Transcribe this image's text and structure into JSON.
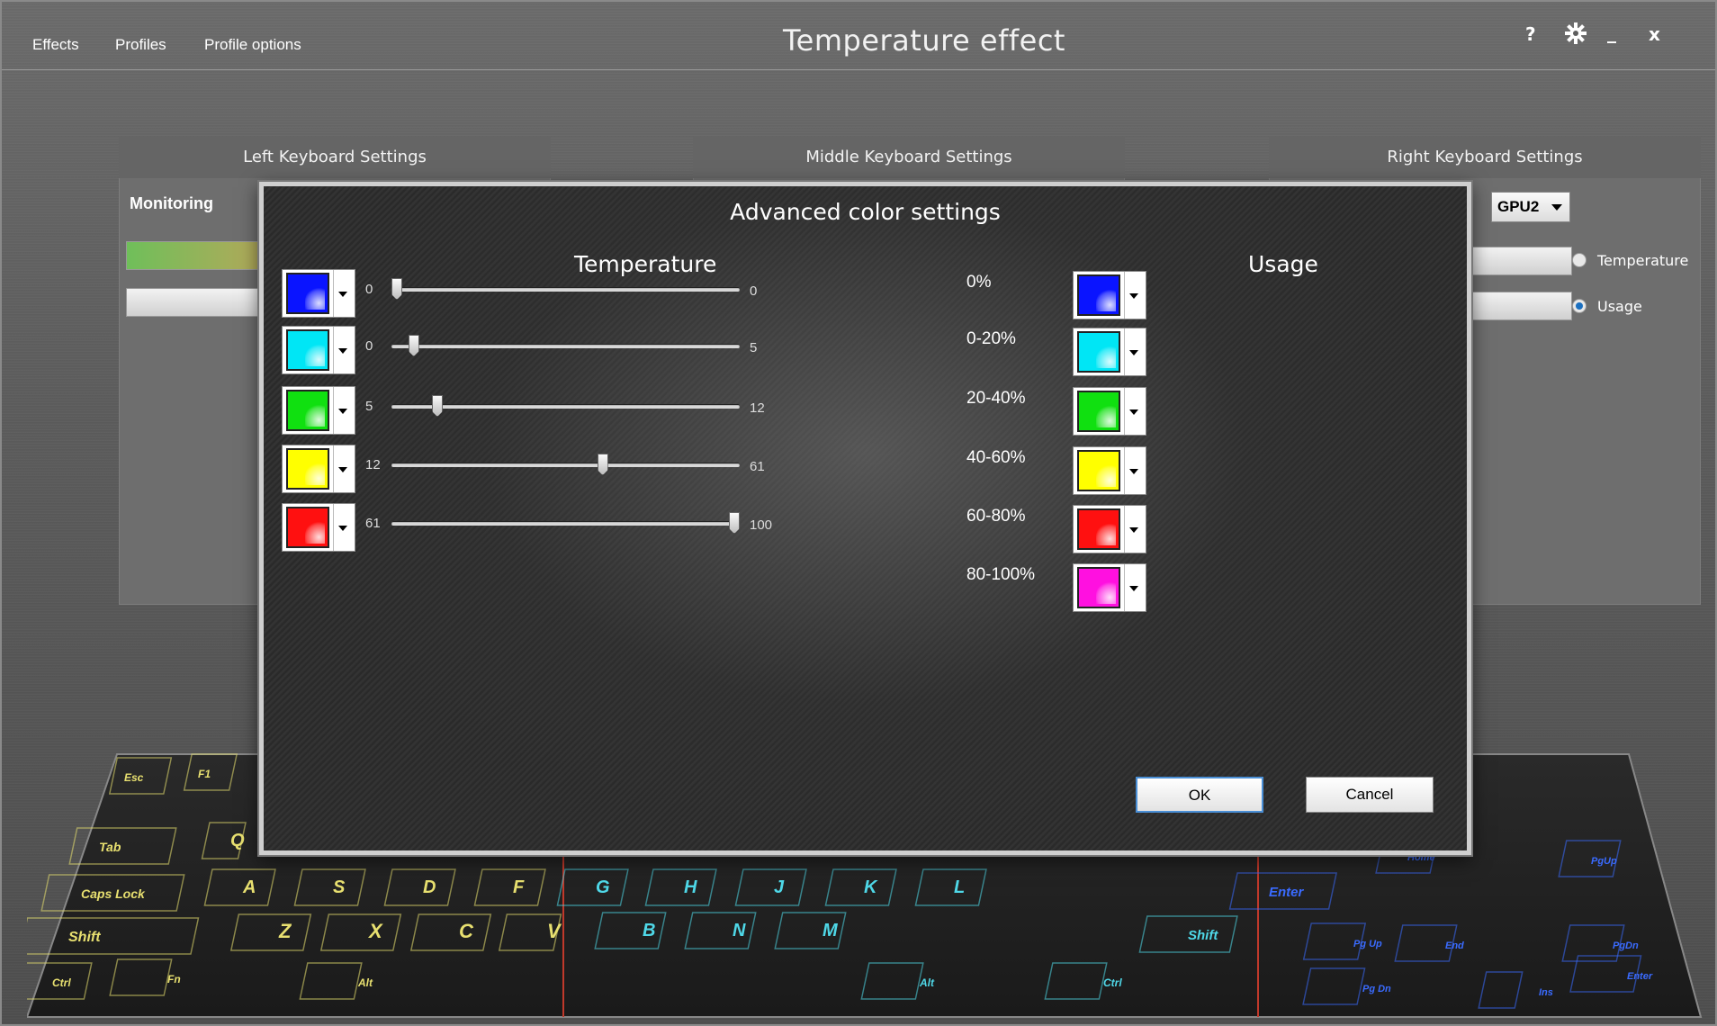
{
  "menu": {
    "effects": "Effects",
    "profiles": "Profiles",
    "profile_options": "Profile options"
  },
  "app_title": "Temperature effect",
  "window_controls": {
    "help": "?",
    "minimize": "_",
    "close": "x"
  },
  "panels": {
    "left": "Left Keyboard Settings",
    "middle": "Middle Keyboard Settings",
    "right": "Right Keyboard Settings"
  },
  "monitoring_label": "Monitoring",
  "gpu_select": {
    "value": "GPU2"
  },
  "mode_radios": [
    {
      "label": "Temperature",
      "selected": false
    },
    {
      "label": "Usage",
      "selected": true
    }
  ],
  "dialog": {
    "title": "Advanced color settings",
    "temperature_title": "Temperature",
    "usage_title": "Usage",
    "temperature_rows": [
      {
        "color": "#0a14ff",
        "min": "0",
        "max": "0",
        "value": 0
      },
      {
        "color": "#00e6f5",
        "min": "0",
        "max": "5",
        "value": 5
      },
      {
        "color": "#10e010",
        "min": "5",
        "max": "12",
        "value": 12
      },
      {
        "color": "#ffff00",
        "min": "12",
        "max": "61",
        "value": 61
      },
      {
        "color": "#ff1010",
        "min": "61",
        "max": "100",
        "value": 100
      }
    ],
    "usage_rows": [
      {
        "label": "0%",
        "color": "#0a14ff"
      },
      {
        "label": "0-20%",
        "color": "#00e6f5"
      },
      {
        "label": "20-40%",
        "color": "#10e010"
      },
      {
        "label": "40-60%",
        "color": "#ffff00"
      },
      {
        "label": "60-80%",
        "color": "#ff1010"
      },
      {
        "label": "80-100%",
        "color": "#ff10e0"
      }
    ],
    "ok_label": "OK",
    "cancel_label": "Cancel"
  },
  "keyboard": {
    "left_color": "#e8e070",
    "middle_color": "#4fd8e8",
    "right_color": "#3a6bff",
    "left_keys": [
      "Esc",
      "F1",
      "Tab",
      "Q",
      "Caps Lock",
      "A",
      "S",
      "D",
      "F",
      "Shift",
      "Z",
      "X",
      "C",
      "V",
      "Ctrl",
      "Fn",
      "Alt"
    ],
    "middle_keys": [
      "G",
      "H",
      "J",
      "K",
      "L",
      "B",
      "N",
      "M",
      "Shift",
      "Alt",
      "Ctrl"
    ],
    "right_keys": [
      "Enter",
      "Home",
      "PgUp",
      "Pg Up",
      "Pg Dn",
      "End",
      "PgDn",
      "Enter",
      "Ins"
    ]
  }
}
